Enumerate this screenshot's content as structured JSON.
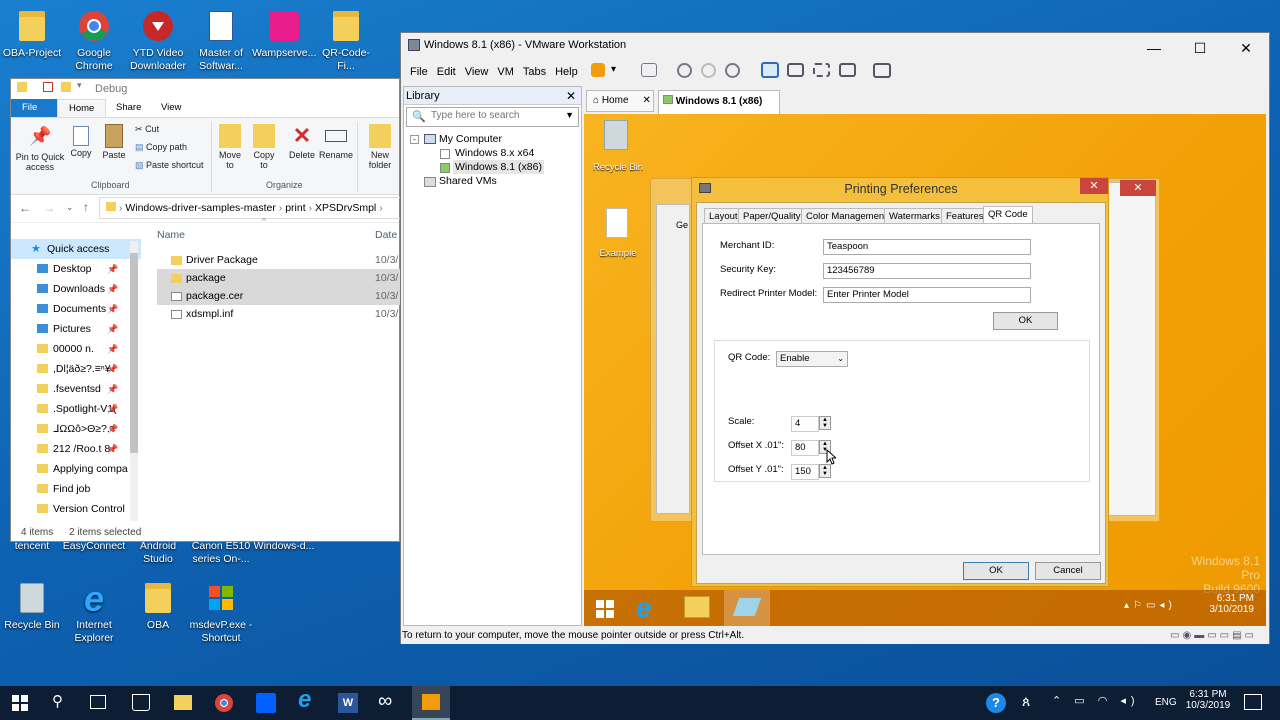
{
  "desktop_icons_top": [
    {
      "label": "OBA-Project",
      "icon": "folder-icon"
    },
    {
      "label": "Google Chrome",
      "icon": "chrome-icon"
    },
    {
      "label": "YTD Video Downloader",
      "icon": "ytd-icon"
    },
    {
      "label": "Master of Softwar...",
      "icon": "document-icon"
    },
    {
      "label": "Wampserve...",
      "icon": "wamp-icon"
    },
    {
      "label": "QR-Code-Fi...",
      "icon": "folder-icon"
    }
  ],
  "desktop_icons_mid": [
    "tencent",
    "EasyConnect",
    "Android Studio",
    "Canon E510 series On-...",
    "Windows-d..."
  ],
  "desktop_icons_bottom": [
    {
      "label": "Recycle Bin",
      "icon": "recycle-bin-icon"
    },
    {
      "label": "Internet Explorer",
      "icon": "ie-icon"
    },
    {
      "label": "OBA",
      "icon": "folder-icon"
    },
    {
      "label": "msdevP.exe - Shortcut",
      "icon": "shortcut-icon"
    }
  ],
  "explorer": {
    "title": "Debug",
    "tabs": [
      "File",
      "Home",
      "Share",
      "View"
    ],
    "ribbon": {
      "pin": "Pin to Quick access",
      "copy": "Copy",
      "paste": "Paste",
      "cut": "Cut",
      "copy_path": "Copy path",
      "paste_shortcut": "Paste shortcut",
      "clipboard": "Clipboard",
      "move_to": "Move to",
      "copy_to": "Copy to",
      "delete": "Delete",
      "rename": "Rename",
      "new_folder": "New folder",
      "organize": "Organize"
    },
    "breadcrumb": [
      "Windows-driver-samples-master",
      "print",
      "XPSDrvSmpl"
    ],
    "nav": [
      {
        "label": "Quick access",
        "icon": "star-icon",
        "pinned": false
      },
      {
        "label": "Desktop",
        "icon": "desktop-icon",
        "pinned": true
      },
      {
        "label": "Downloads",
        "icon": "download-icon",
        "pinned": true
      },
      {
        "label": "Documents",
        "icon": "documents-icon",
        "pinned": true
      },
      {
        "label": "Pictures",
        "icon": "pictures-icon",
        "pinned": true
      },
      {
        "label": "00000 n.",
        "icon": "folder-icon",
        "pinned": true
      },
      {
        "label": ",Dl¦äð≥?.≡ⁿ¥",
        "icon": "folder-icon",
        "pinned": true
      },
      {
        "label": ".fseventsd",
        "icon": "folder-icon",
        "pinned": true
      },
      {
        "label": ".Spotlight-V1(",
        "icon": "folder-icon",
        "pinned": true
      },
      {
        "label": "ᒧΩΩô>Θ≥?.≡",
        "icon": "folder-icon",
        "pinned": true
      },
      {
        "label": "212 /Roo.t 8",
        "icon": "folder-icon",
        "pinned": true
      },
      {
        "label": "Applying compa",
        "icon": "folder-icon",
        "pinned": false
      },
      {
        "label": "Find job",
        "icon": "folder-icon",
        "pinned": false
      },
      {
        "label": "Version Control",
        "icon": "folder-icon",
        "pinned": false
      }
    ],
    "columns": {
      "name": "Name",
      "date": "Date m"
    },
    "files": [
      {
        "name": "Driver Package",
        "date": "10/3/",
        "selected": false,
        "icon": "folder-icon"
      },
      {
        "name": "package",
        "date": "10/3/",
        "selected": true,
        "icon": "folder-icon"
      },
      {
        "name": "package.cer",
        "date": "10/3/",
        "selected": true,
        "icon": "certificate-icon"
      },
      {
        "name": "xdsmpl.inf",
        "date": "10/3/",
        "selected": false,
        "icon": "inf-file-icon"
      }
    ],
    "status_items": "4 items",
    "status_selected": "2 items selected"
  },
  "vmware": {
    "title": "Windows 8.1 (x86) - VMware Workstation",
    "menu": [
      "File",
      "Edit",
      "View",
      "VM",
      "Tabs",
      "Help"
    ],
    "library_title": "Library",
    "search_placeholder": "Type here to search",
    "tree": {
      "root": "My Computer",
      "vm1": "Windows 8.x x64",
      "vm2": "Windows 8.1 (x86)",
      "shared": "Shared VMs"
    },
    "tabs": {
      "home": "Home",
      "vm": "Windows 8.1 (x86)"
    },
    "status": "To return to your computer, move the mouse pointer outside or press Ctrl+Alt."
  },
  "guest": {
    "recycle": "Recycle Bin",
    "example": "Example",
    "watermark1": "Windows 8.1 Pro",
    "watermark2": "Build 9600",
    "time": "6:31 PM",
    "date": "3/10/2019",
    "behind_tab": "Ge"
  },
  "dialog": {
    "title": "Printing Preferences",
    "tabs": [
      "Layout",
      "Paper/Quality",
      "Color Management",
      "Watermarks",
      "Features",
      "QR Code"
    ],
    "merchant_label": "Merchant ID:",
    "merchant_value": "Teaspoon",
    "security_label": "Security Key:",
    "security_value": "123456789",
    "redirect_label": "Redirect Printer Model:",
    "redirect_value": "Enter Printer Model",
    "ok_small": "OK",
    "qr_label": "QR Code:",
    "qr_value": "Enable",
    "scale_label": "Scale:",
    "scale_value": "4",
    "offx_label": "Offset X .01\":",
    "offx_value": "80",
    "offy_label": "Offset Y .01\":",
    "offy_value": "150",
    "ok": "OK",
    "cancel": "Cancel"
  },
  "taskbar": {
    "lang": "ENG",
    "time": "6:31 PM",
    "date": "10/3/2019"
  },
  "colors": {
    "desktop": "#0e63b3",
    "guest_bg": "#f3a007",
    "dialog_border": "#f3bf3c",
    "taskbar": "#0d1d34",
    "selection": "#cce8ff"
  }
}
